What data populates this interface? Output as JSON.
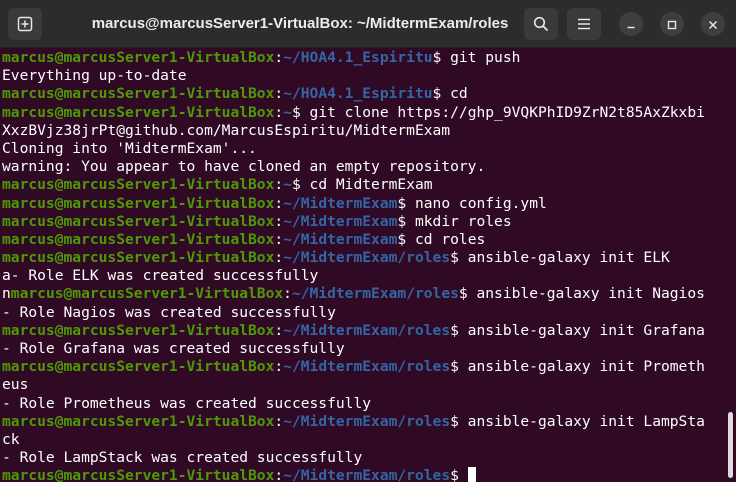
{
  "window": {
    "title": "marcus@marcusServer1-VirtualBox: ~/MidtermExam/roles"
  },
  "colors": {
    "background": "#300a24",
    "user_host": "#4e9a06",
    "path": "#3465a4",
    "text": "#ffffff"
  },
  "icons": {
    "new_tab": "new-tab-icon",
    "search": "search-icon",
    "menu": "hamburger-menu-icon",
    "minimize": "minimize-icon",
    "maximize": "maximize-icon",
    "close": "close-icon"
  },
  "terminal": {
    "lines": [
      {
        "user": "marcus@marcusServer1-VirtualBox",
        "sep": ":",
        "path": "~/HOA4.1_Espiritu",
        "cmd": "$ git push"
      },
      {
        "text": "Everything up-to-date"
      },
      {
        "user": "marcus@marcusServer1-VirtualBox",
        "sep": ":",
        "path": "~/HOA4.1_Espiritu",
        "cmd": "$ cd"
      },
      {
        "user": "marcus@marcusServer1-VirtualBox",
        "sep": ":",
        "path": "~",
        "cmd": "$ git clone https://ghp_9VQKPhID9ZrN2t85AxZkxbi"
      },
      {
        "text": "XxzBVjz38jrPt@github.com/MarcusEspiritu/MidtermExam"
      },
      {
        "text": "Cloning into 'MidtermExam'..."
      },
      {
        "text": "warning: You appear to have cloned an empty repository."
      },
      {
        "user": "marcus@marcusServer1-VirtualBox",
        "sep": ":",
        "path": "~",
        "cmd": "$ cd MidtermExam"
      },
      {
        "user": "marcus@marcusServer1-VirtualBox",
        "sep": ":",
        "path": "~/MidtermExam",
        "cmd": "$ nano config.yml"
      },
      {
        "user": "marcus@marcusServer1-VirtualBox",
        "sep": ":",
        "path": "~/MidtermExam",
        "cmd": "$ mkdir roles"
      },
      {
        "user": "marcus@marcusServer1-VirtualBox",
        "sep": ":",
        "path": "~/MidtermExam",
        "cmd": "$ cd roles"
      },
      {
        "user": "marcus@marcusServer1-VirtualBox",
        "sep": ":",
        "path": "~/MidtermExam/roles",
        "cmd": "$ ansible-galaxy init ELK"
      },
      {
        "text": "a- Role ELK was created successfully"
      },
      {
        "pre": "n",
        "user": "marcus@marcusServer1-VirtualBox",
        "sep": ":",
        "path": "~/MidtermExam/roles",
        "cmd": "$ ansible-galaxy init Nagios"
      },
      {
        "text": "- Role Nagios was created successfully"
      },
      {
        "user": "marcus@marcusServer1-VirtualBox",
        "sep": ":",
        "path": "~/MidtermExam/roles",
        "cmd": "$ ansible-galaxy init Grafana"
      },
      {
        "text": "- Role Grafana was created successfully"
      },
      {
        "user": "marcus@marcusServer1-VirtualBox",
        "sep": ":",
        "path": "~/MidtermExam/roles",
        "cmd": "$ ansible-galaxy init Prometh"
      },
      {
        "text": "eus"
      },
      {
        "text": "- Role Prometheus was created successfully"
      },
      {
        "user": "marcus@marcusServer1-VirtualBox",
        "sep": ":",
        "path": "~/MidtermExam/roles",
        "cmd": "$ ansible-galaxy init LampSta"
      },
      {
        "text": "ck"
      },
      {
        "text": "- Role LampStack was created successfully"
      },
      {
        "user": "marcus@marcusServer1-VirtualBox",
        "sep": ":",
        "path": "~/MidtermExam/roles",
        "cmd": "$ ",
        "cursor": true
      }
    ]
  }
}
